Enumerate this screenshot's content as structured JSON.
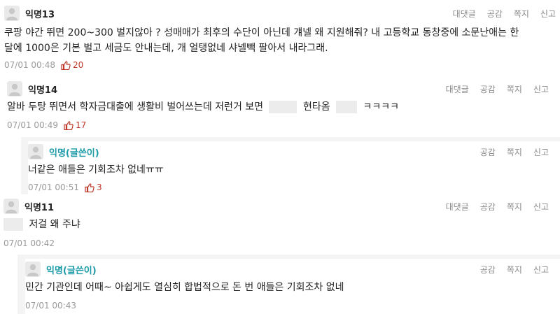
{
  "comments": [
    {
      "author": "익명13",
      "actions": [
        "대댓글",
        "공감",
        "쪽지",
        "신고"
      ],
      "text_line1": "쿠팡 야간 뛰면 200~300 벌지않아 ? 성매매가 최후의 수단이 아닌데 걔넬 왜 지원해줘? 내 고등학교 동창중에 소문난애는 한",
      "text_line2": "달에 1000은 기본 벌고 세금도 안내는데, 개 얼탱없네 샤넬빽 팔아서 내라그래.",
      "time": "07/01 00:48",
      "likes": "20"
    },
    {
      "author": "익명14",
      "actions": [
        "대댓글",
        "공감",
        "쪽지",
        "신고"
      ],
      "text_a": "알바 두탕 뛰면서 학자금대출에 생활비 벌어쓰는데 저런거 보면",
      "text_b": "현타옴",
      "text_c": "ㅋㅋㅋㅋ",
      "time": "07/01 00:49",
      "likes": "17"
    },
    {
      "author": "익명(글쓴이)",
      "actions": [
        "공감",
        "쪽지",
        "신고"
      ],
      "text": "너같은 애들은 기회조차 없네ㅠㅠ",
      "time": "07/01 00:51",
      "likes": "3"
    },
    {
      "author": "익명11",
      "actions": [
        "대댓글",
        "공감",
        "쪽지",
        "신고"
      ],
      "text": "저걸 왜 주냐",
      "time": "07/01 00:42"
    },
    {
      "author": "익명(글쓴이)",
      "actions": [
        "공감",
        "쪽지",
        "신고"
      ],
      "text": "민간 기관인데 어때~ 아쉽게도 열심히 합법적으로 돈 번 애들은 기회조차 없네",
      "time": "07/01 00:43"
    }
  ],
  "colors": {
    "op_author": "#1a9aa6",
    "like": "#c0392b",
    "muted": "#9a9a9a"
  }
}
